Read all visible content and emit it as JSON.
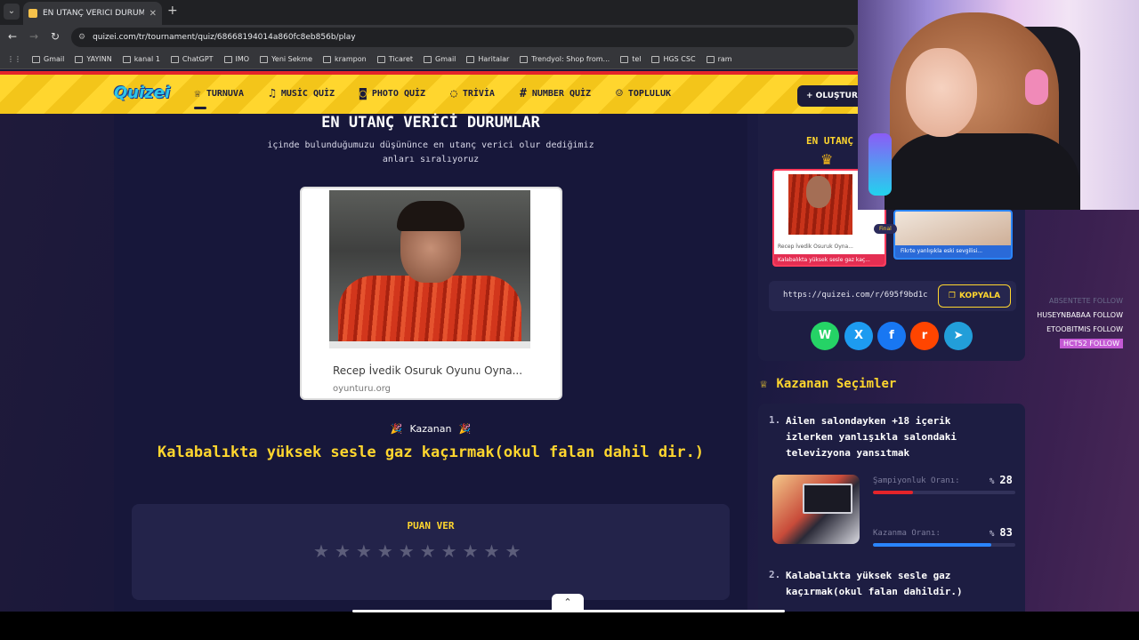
{
  "browser": {
    "tab_title": "EN UTANÇ VERİCİ DURUMLAR",
    "url": "quizei.com/tr/tournament/quiz/68668194014a860fc8eb856b/play",
    "bookmarks": [
      "Gmail",
      "YAYINN",
      "kanal 1",
      "ChatGPT",
      "IMO",
      "Yeni Sekme",
      "krampon",
      "Ticaret",
      "Gmail",
      "Haritalar",
      "Trendyol: Shop from...",
      "tel",
      "HGS CSC",
      "ram"
    ]
  },
  "site": {
    "logo": "Quizei",
    "nav": [
      "TURNUVA",
      "MUSİC QUİZ",
      "PHOTO QUİZ",
      "TRİVİA",
      "NUMBER QUİZ",
      "TOPLULUK"
    ],
    "create_button": "+ OLUŞTUR"
  },
  "quiz": {
    "title": "EN UTANÇ VERİCİ DURUMLAR",
    "description": "içinde bulunduğumuzu düşününce en utanç verici olur dediğimiz anları sıralıyoruz",
    "card_caption": "Recep İvedik Osuruk Oyunu Oyna...",
    "card_source": "oyunturu.org",
    "winner_label": "Kazanan",
    "winner_text": "Kalabalıkta yüksek sesle gaz kaçırmak(okul falan dahil dir.)",
    "rate_title": "PUAN VER",
    "star_count": 10
  },
  "sidebar": {
    "title": "EN UTANÇ",
    "mini_left_caption": "Recep İvedik Osuruk Oyna...",
    "mini_left_label": "Kalabalıkta yüksek sesle gaz kaç...",
    "mini_right_label": "Fikrte yanlışıkla eski sevgilisi...",
    "final_badge": "Final",
    "share_url": "https://quizei.com/r/695f9bd1c",
    "copy_button": "KOPYALA",
    "social": [
      {
        "name": "whatsapp",
        "glyph": "W",
        "color": "#25d366"
      },
      {
        "name": "x",
        "glyph": "X",
        "color": "#1d9bf0"
      },
      {
        "name": "facebook",
        "glyph": "f",
        "color": "#1877f2"
      },
      {
        "name": "reddit",
        "glyph": "r",
        "color": "#ff4500"
      },
      {
        "name": "telegram",
        "glyph": "➤",
        "color": "#229ed9"
      }
    ],
    "winners_title": "Kazanan Seçimler",
    "winners": [
      {
        "num": "1.",
        "text_lines": [
          "Ailen salondayken +18 içerik",
          "izlerken yanlışıkla salondaki",
          "televizyona yansıtmak"
        ],
        "champion_label": "Şampiyonluk Oranı:",
        "champion_pct": "28",
        "win_label": "Kazanma Oranı:",
        "win_pct": "83",
        "pct_sign": "%"
      },
      {
        "num": "2.",
        "text_lines": [
          "Kalabalıkta yüksek sesle gaz",
          "kaçırmak(okul falan dahildir.)"
        ]
      }
    ],
    "colors": {
      "champion_bar": "#e4242a",
      "win_bar": "#2a85ff",
      "accent": "#ffd62e"
    }
  },
  "stream_follows": [
    {
      "name": "ABSENTETE",
      "action": "FOLLOW",
      "style": "dim"
    },
    {
      "name": "HUSEYNBABAA",
      "action": "FOLLOW",
      "style": "normal"
    },
    {
      "name": "ETOOBITMIS",
      "action": "FOLLOW",
      "style": "normal"
    },
    {
      "name": "HCT52",
      "action": "FOLLOW",
      "style": "hl"
    }
  ]
}
